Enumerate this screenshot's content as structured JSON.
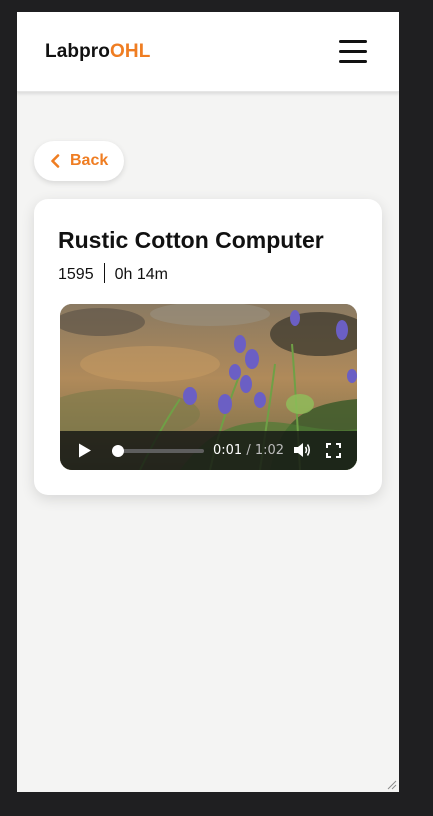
{
  "header": {
    "brand_prefix": "Labpro",
    "brand_suffix": "OHL",
    "brand_accent_color": "#ef7d22",
    "menu_icon": "hamburger-menu-icon"
  },
  "back": {
    "label": "Back",
    "icon": "chevron-left-icon"
  },
  "card": {
    "title": "Rustic Cotton Computer",
    "code": "1595",
    "duration": "0h 14m"
  },
  "video": {
    "current_time": "0:01",
    "separator": " / ",
    "total_time": "1:02",
    "progress_fraction": 0.016,
    "play_icon": "play-icon",
    "volume_icon": "volume-icon",
    "fullscreen_icon": "fullscreen-icon"
  }
}
